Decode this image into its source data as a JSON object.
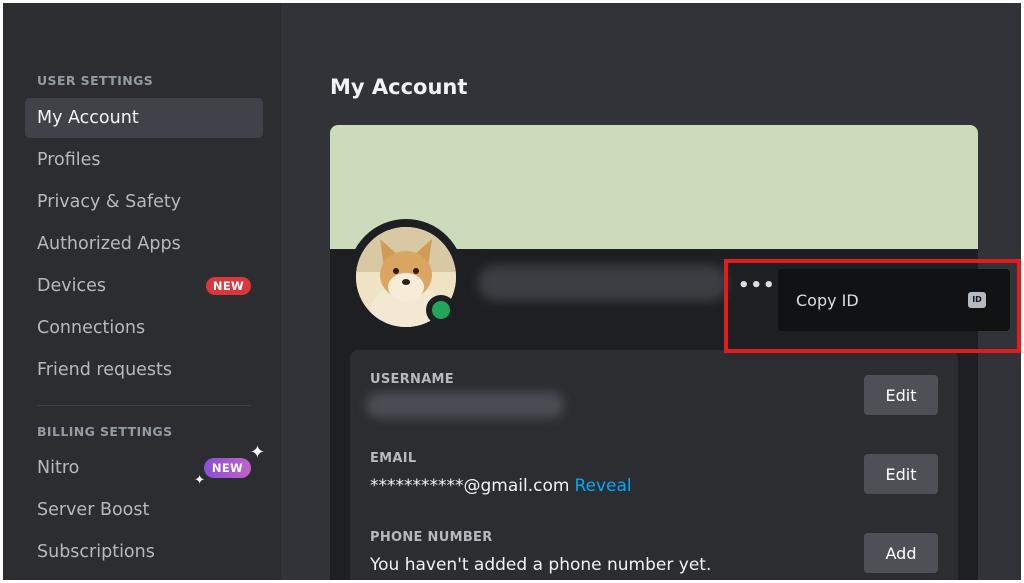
{
  "sidebar": {
    "user_settings_header": "USER SETTINGS",
    "billing_settings_header": "BILLING SETTINGS",
    "items": [
      {
        "label": "My Account"
      },
      {
        "label": "Profiles"
      },
      {
        "label": "Privacy & Safety"
      },
      {
        "label": "Authorized Apps"
      },
      {
        "label": "Devices",
        "badge": "NEW"
      },
      {
        "label": "Connections"
      },
      {
        "label": "Friend requests"
      }
    ],
    "billing_items": [
      {
        "label": "Nitro",
        "badge": "NEW"
      },
      {
        "label": "Server Boost"
      },
      {
        "label": "Subscriptions"
      }
    ]
  },
  "main": {
    "title": "My Account",
    "more_icon": "•••",
    "fields": [
      {
        "label": "USERNAME",
        "button": "Edit"
      },
      {
        "label": "EMAIL",
        "value": "***********@gmail.com",
        "link": "Reveal",
        "button": "Edit"
      },
      {
        "label": "PHONE NUMBER",
        "value": "You haven't added a phone number yet.",
        "button": "Add"
      }
    ]
  },
  "context_menu": {
    "item_label": "Copy ID",
    "item_icon": "ID"
  },
  "colors": {
    "accent_link": "#00a8fc",
    "badge_red": "#da373c",
    "status_online": "#23a55a",
    "highlight": "#e21c1c",
    "banner": "#cbdbbc"
  }
}
